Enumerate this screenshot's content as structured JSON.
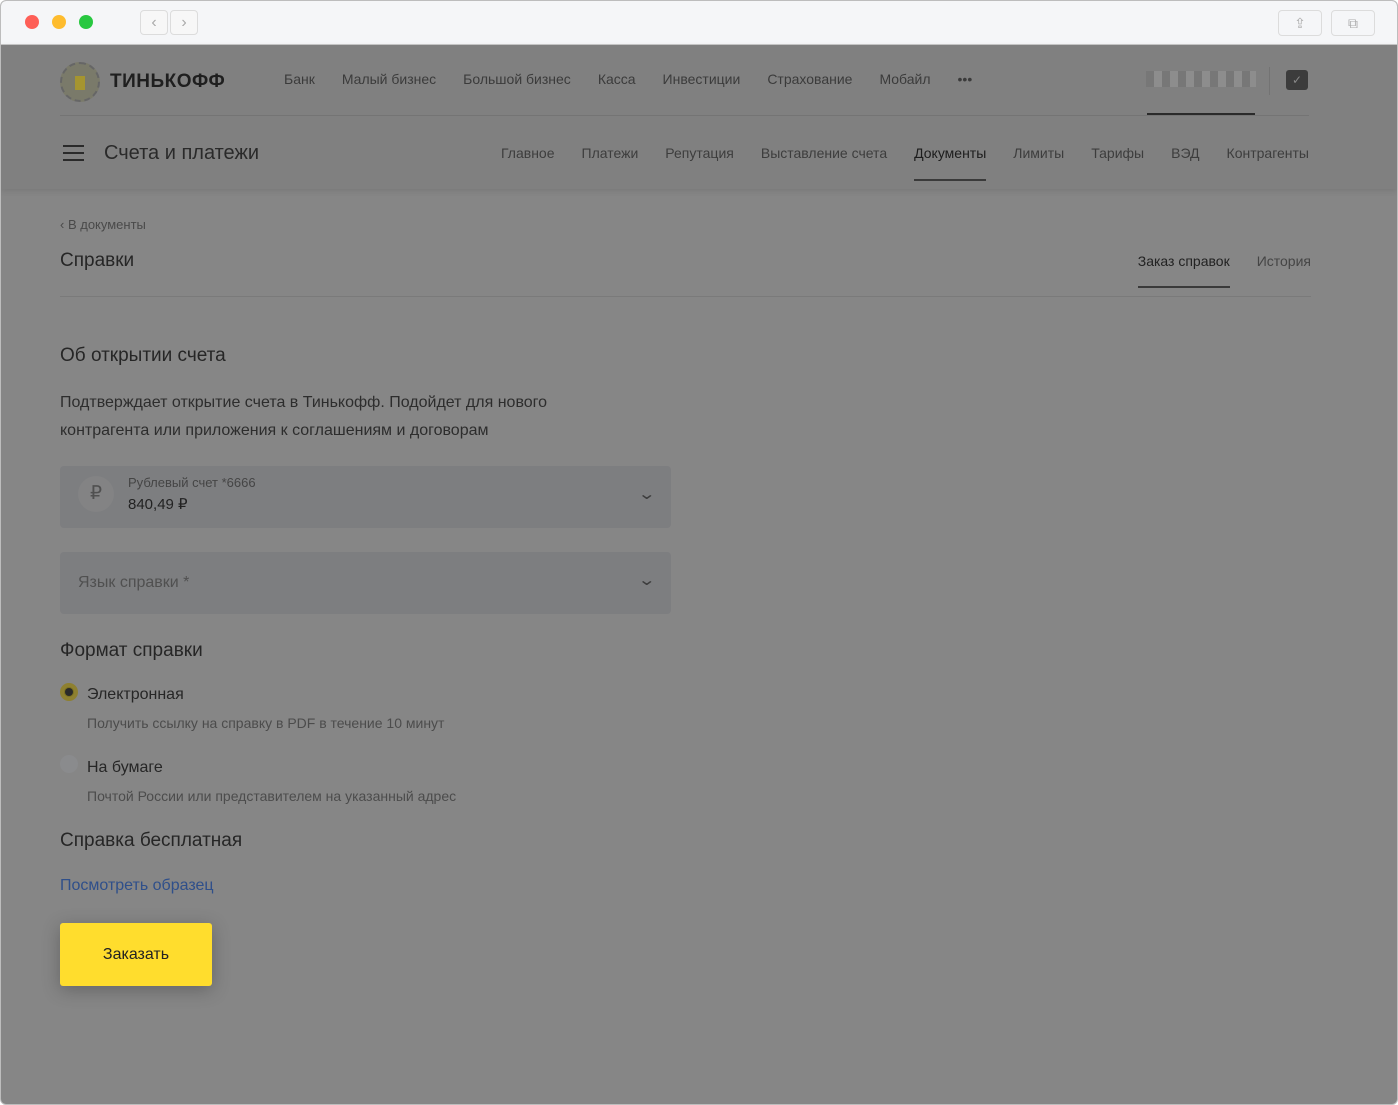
{
  "browser": {
    "back": "‹",
    "forward": "›"
  },
  "header": {
    "logo": "ТИНЬКОФФ",
    "nav": [
      "Банк",
      "Малый бизнес",
      "Большой бизнес",
      "Касса",
      "Инвестиции",
      "Страхование",
      "Мобайл",
      "•••"
    ],
    "section": "Счета и платежи",
    "subnav": [
      "Главное",
      "Платежи",
      "Репутация",
      "Выставление счета",
      "Документы",
      "Лимиты",
      "Тарифы",
      "ВЭД",
      "Контрагенты"
    ],
    "active_subnav": "Документы"
  },
  "page": {
    "back": "В документы",
    "title": "Справки",
    "tabs": [
      "Заказ справок",
      "История"
    ],
    "heading": "Об открытии счета",
    "description": "Подтверждает открытие счета в Тинькофф. Подойдет для нового контрагента или приложения к соглашениям и договорам",
    "account": {
      "label": "Рублевый счет *6666",
      "balance": "840,49 ₽",
      "icon": "₽"
    },
    "language_placeholder": "Язык справки *",
    "format_heading": "Формат справки",
    "formats": [
      {
        "label": "Электронная",
        "sub": "Получить ссылку на справку в PDF в течение 10 минут",
        "selected": true
      },
      {
        "label": "На бумаге",
        "sub": "Почтой России или представителем на указанный адрес",
        "selected": false
      }
    ],
    "free": "Справка бесплатная",
    "sample_link": "Посмотреть образец",
    "order_button": "Заказать"
  },
  "colors": {
    "accent": "#ffdd2d",
    "link": "#2f4f8a"
  }
}
